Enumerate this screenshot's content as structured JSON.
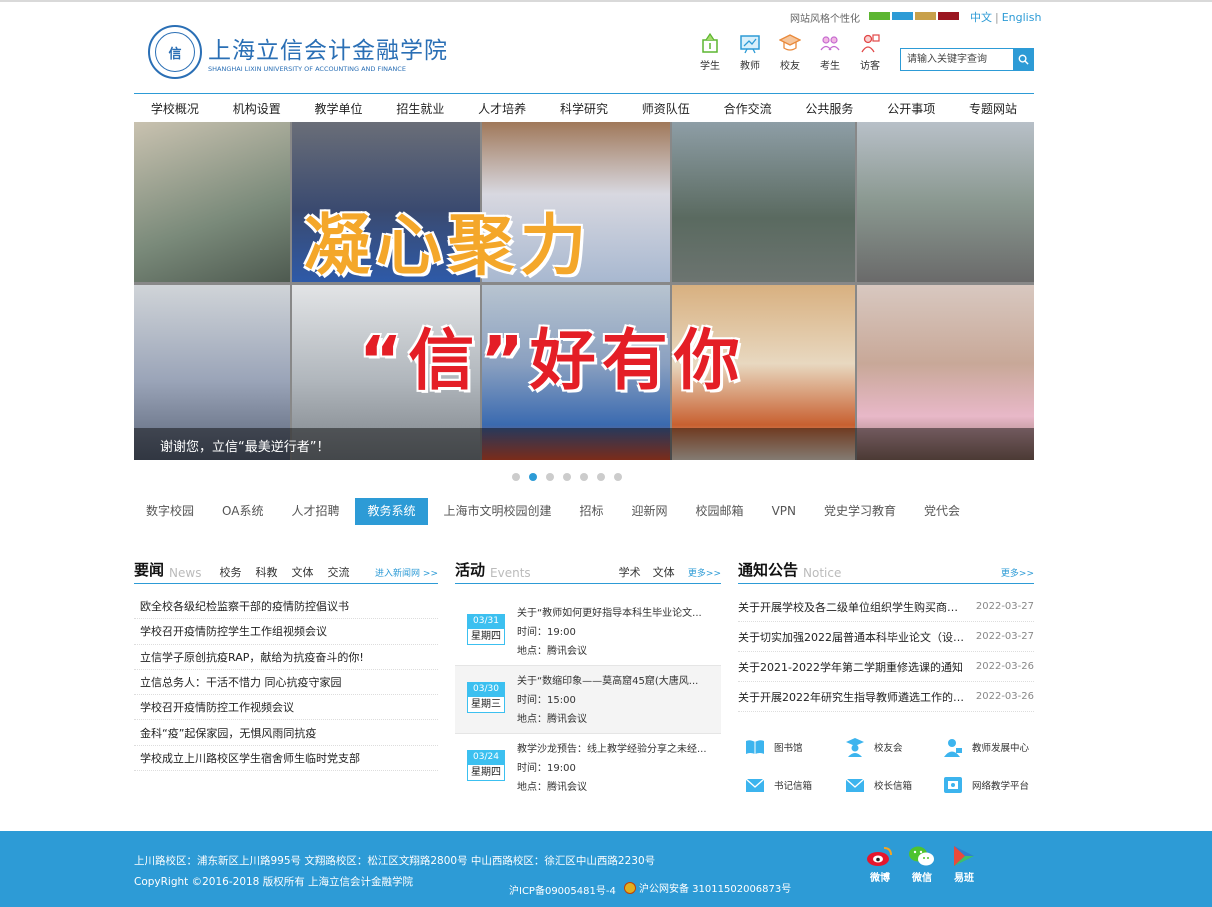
{
  "header": {
    "logo_cn": "上海立信会计金融学院",
    "logo_en": "SHANGHAI LIXIN UNIVERSITY OF ACCOUNTING AND FINANCE",
    "style_label": "网站风格个性化",
    "style_colors": [
      "#5cb531",
      "#2d9bd6",
      "#c8a04a",
      "#9a1620"
    ],
    "lang_cn": "中文",
    "lang_sep": "|",
    "lang_en": "English",
    "roles": [
      {
        "label": "学生",
        "icon": "student-icon"
      },
      {
        "label": "教师",
        "icon": "teacher-icon"
      },
      {
        "label": "校友",
        "icon": "alumni-icon"
      },
      {
        "label": "考生",
        "icon": "applicant-icon"
      },
      {
        "label": "访客",
        "icon": "visitor-icon"
      }
    ],
    "search_placeholder": "请输入关键字查询"
  },
  "nav": [
    "学校概况",
    "机构设置",
    "教学单位",
    "招生就业",
    "人才培养",
    "科学研究",
    "师资队伍",
    "合作交流",
    "公共服务",
    "公开事项",
    "专题网站"
  ],
  "banner": {
    "headline_1": "凝心聚力",
    "headline_2": "“信”好有你",
    "caption": "谢谢您，立信“最美逆行者”！",
    "active_dot": 1,
    "dot_count": 7
  },
  "quick_links": [
    "数字校园",
    "OA系统",
    "人才招聘",
    "教务系统",
    "上海市文明校园创建",
    "招标",
    "迎新网",
    "校园邮箱",
    "VPN",
    "党史学习教育",
    "党代会"
  ],
  "quick_active": 3,
  "news": {
    "title": "要闻",
    "title_en": "News",
    "tabs": [
      "校务",
      "科教",
      "文体",
      "交流"
    ],
    "more": "进入新闻网 >>",
    "items": [
      "欧全校各级纪检监察干部的疫情防控倡议书",
      "学校召开疫情防控学生工作组视频会议",
      "立信学子原创抗疫RAP，献给为抗疫奋斗的你!",
      "立信总务人：干活不惜力 同心抗疫守家园",
      "学校召开疫情防控工作视频会议",
      "金科“疫”起保家园，无惧风雨同抗疫",
      "学校成立上川路校区学生宿舍师生临时党支部"
    ]
  },
  "events": {
    "title": "活动",
    "title_en": "Events",
    "tabs": [
      "学术",
      "文体"
    ],
    "more": "更多>>",
    "time_label": "时间：",
    "place_label": "地点：",
    "items": [
      {
        "date": "03/31",
        "weekday": "星期四",
        "title": "关于“教师如何更好指导本科生毕业论文...",
        "time": "19:00",
        "place": "腾讯会议"
      },
      {
        "date": "03/30",
        "weekday": "星期三",
        "title": "关于“数缩印象——莫高窟45窟(大唐风...",
        "time": "15:00",
        "place": "腾讯会议"
      },
      {
        "date": "03/24",
        "weekday": "星期四",
        "title": "教学沙龙预告：线上教学经验分享之未经...",
        "time": "19:00",
        "place": "腾讯会议"
      }
    ]
  },
  "notices": {
    "title": "通知公告",
    "title_en": "Notice",
    "more": "更多>>",
    "items": [
      {
        "title": "关于开展学校及各二级单位组织学生购买商业...",
        "date": "2022-03-27"
      },
      {
        "title": "关于切实加强2022届普通本科毕业论文（设计...",
        "date": "2022-03-27"
      },
      {
        "title": "关于2021-2022学年第二学期重修选课的通知",
        "date": "2022-03-26"
      },
      {
        "title": "关于开展2022年研究生指导教师遴选工作的通...",
        "date": "2022-03-26"
      }
    ]
  },
  "services": [
    {
      "label": "图书馆",
      "icon": "book-icon"
    },
    {
      "label": "校友会",
      "icon": "graduate-icon"
    },
    {
      "label": "教师发展中心",
      "icon": "teacher-center-icon"
    },
    {
      "label": "书记信箱",
      "icon": "mail-icon"
    },
    {
      "label": "校长信箱",
      "icon": "mail-icon"
    },
    {
      "label": "网络教学平台",
      "icon": "platform-icon"
    }
  ],
  "footer": {
    "addresses": "上川路校区：浦东新区上川路995号    文翔路校区：松江区文翔路2800号    中山西路校区：徐汇区中山西路2230号",
    "copyright": "CopyRight ©2016-2018    版权所有    上海立信会计金融学院",
    "icp": "沪ICP备09005481号-4",
    "police": "沪公网安备 31011502006873号",
    "social": [
      {
        "label": "微博",
        "icon": "weibo-icon"
      },
      {
        "label": "微信",
        "icon": "wechat-icon"
      },
      {
        "label": "易班",
        "icon": "yiban-icon"
      }
    ]
  }
}
